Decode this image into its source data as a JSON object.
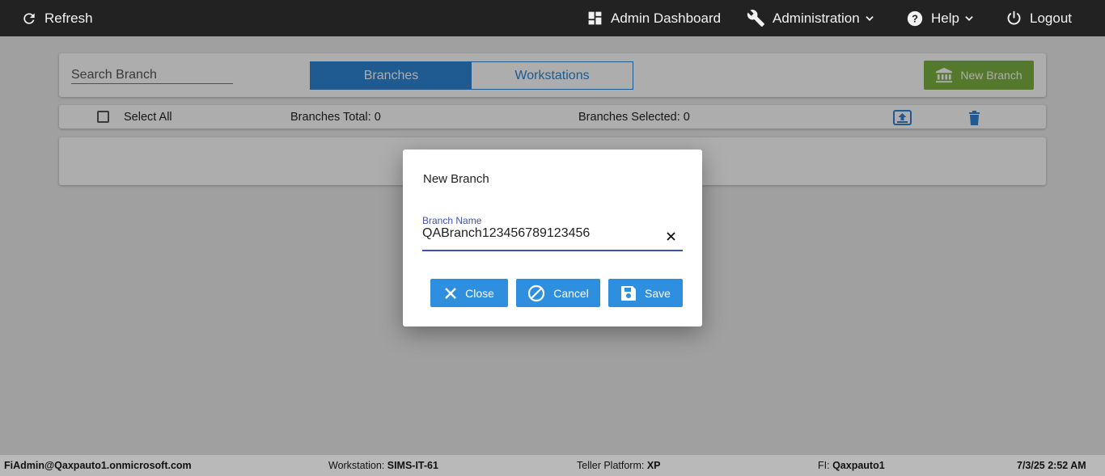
{
  "topbar": {
    "refresh_label": "Refresh",
    "admin_dashboard_label": "Admin Dashboard",
    "administration_label": "Administration",
    "help_label": "Help",
    "logout_label": "Logout"
  },
  "search": {
    "placeholder": "Search Branch",
    "value": ""
  },
  "tabs": [
    {
      "label": "Branches",
      "active": true
    },
    {
      "label": "Workstations",
      "active": false
    }
  ],
  "new_branch_button": {
    "label": "New Branch"
  },
  "toolbar": {
    "select_all_label": "Select All",
    "branches_total": "Branches Total: 0",
    "branches_selected": "Branches Selected: 0"
  },
  "dialog": {
    "title": "New Branch",
    "field_label": "Branch Name",
    "field_value": "QABranch123456789123456",
    "close_label": "Close",
    "cancel_label": "Cancel",
    "save_label": "Save"
  },
  "footer": {
    "user": "FiAdmin@Qaxpauto1.onmicrosoft.com",
    "workstation_label": "Workstation:",
    "workstation_value": "SIMS-IT-61",
    "teller_platform_label": "Teller Platform:",
    "teller_platform_value": "XP",
    "fi_label": "FI:",
    "fi_value": "Qaxpauto1",
    "datetime": "7/3/25 2:52 AM"
  },
  "colors": {
    "accent": "#2e86d6",
    "new_branch": "#7cb342",
    "field_underline": "#3f51b5",
    "topbar": "#222222"
  }
}
